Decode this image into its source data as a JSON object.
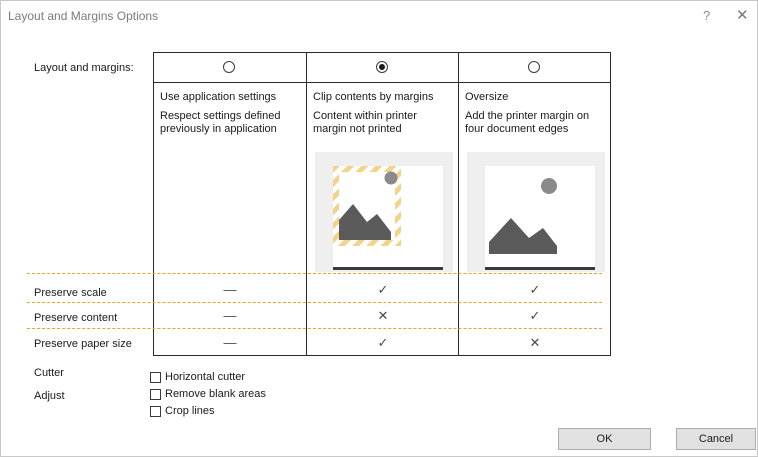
{
  "window": {
    "title": "Layout and Margins Options",
    "help_glyph": "?",
    "close_glyph": "✕"
  },
  "layout": {
    "label": "Layout and margins:",
    "options": [
      {
        "title": "Use application settings",
        "description": "Respect settings defined previously in application",
        "selected": false
      },
      {
        "title": "Clip contents by margins",
        "description": "Content within printer margin not printed",
        "selected": true
      },
      {
        "title": "Oversize",
        "description": "Add the printer margin on four document edges",
        "selected": false
      }
    ]
  },
  "features": [
    {
      "label": "Preserve scale",
      "values": [
        "—",
        "✓",
        "✓"
      ]
    },
    {
      "label": "Preserve content",
      "values": [
        "—",
        "✕",
        "✓"
      ]
    },
    {
      "label": "Preserve paper size",
      "values": [
        "—",
        "✓",
        "✕"
      ]
    }
  ],
  "cutter": {
    "label": "Cutter",
    "option": "Horizontal cutter",
    "checked": false
  },
  "adjust": {
    "label": "Adjust",
    "options": [
      {
        "label": "Remove blank areas",
        "checked": false
      },
      {
        "label": "Crop lines",
        "checked": false
      }
    ]
  },
  "buttons": {
    "ok": "OK",
    "cancel": "Cancel"
  },
  "colors": {
    "dashed_separator": "#f0a030",
    "margin_hatch": "#f3d28a",
    "image_glyph": "#5a5a5a"
  },
  "icons": [
    "radio-unselected",
    "radio-selected",
    "mountain-image-icon",
    "checkmark-icon",
    "cross-icon",
    "dash-icon"
  ]
}
